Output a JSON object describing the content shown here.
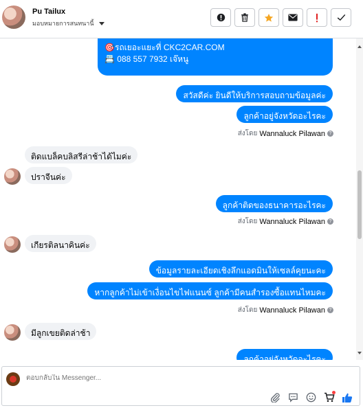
{
  "header": {
    "contact_name": "Pu Tailux",
    "assign_label": "มอบหมายการสนทนานี้",
    "tools": [
      "alert-circle-icon",
      "trash-icon",
      "star-icon",
      "mail-icon",
      "exclamation-icon",
      "check-icon"
    ]
  },
  "messages": {
    "partial_line1": "🎯รถเยอะแยะที่ CKC2CAR.COM",
    "partial_line2": "📇 088 557 7932 เจ๊หนู",
    "out1": "สวัสดีค่ะ  ยินดีให้บริการสอบถามข้อมูลค่ะ",
    "out2": "ลูกค้าอยู่จังหวัดอะไรคะ",
    "in1": "ติดแบล็คบลิสรีล่าช้าได้ไมค่ะ",
    "in2": "ปราจีนค่ะ",
    "out3": "ลูกค้าติดของธนาคารอะไรคะ",
    "in3": "เกียรติลนาคินค่ะ",
    "out4": "ข้อมูลรายละเอียดเชิงลึกแอดมินให้เซลล์คุยนะคะ",
    "out5": "หากลูกค้าไม่เข้าเงื่อนไขไฟแนนซ์  ลูกค้ามีคนสำรองซื้อแทนไหมคะ",
    "in4": "มีลูกเขยติดล่าช้า",
    "out6": "ลูกค้าอยู่จังหวัดอะไรคะ"
  },
  "sent_by": {
    "prefix": "ส่งโดย",
    "agent": "Wannaluck Pilawan"
  },
  "composer": {
    "placeholder": "ตอบกลับใน Messenger..."
  },
  "colors": {
    "outgoing_bubble": "#0084ff",
    "incoming_bubble": "#f0f2f5",
    "like": "#1877f2"
  }
}
